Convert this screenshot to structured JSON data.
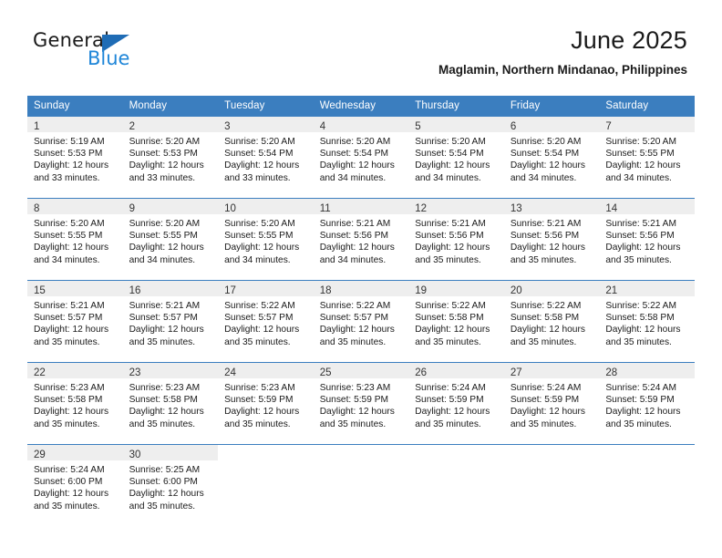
{
  "brand": {
    "name_top": "General",
    "name_bottom": "Blue",
    "triangle_color": "#1f6cb5",
    "blue_text_color": "#1f86d8"
  },
  "header": {
    "title": "June 2025",
    "subtitle": "Maglamin, Northern Mindanao, Philippines"
  },
  "theme": {
    "header_bg": "#3b7ebf",
    "header_text": "#ffffff",
    "daynum_bg": "#eeeeee",
    "grid_line": "#3b7ebf"
  },
  "calendar": {
    "weekday_headers": [
      "Sunday",
      "Monday",
      "Tuesday",
      "Wednesday",
      "Thursday",
      "Friday",
      "Saturday"
    ],
    "labels": {
      "sunrise": "Sunrise:",
      "sunset": "Sunset:",
      "daylight": "Daylight:"
    },
    "weeks": [
      [
        {
          "day": "1",
          "sunrise": "Sunrise: 5:19 AM",
          "sunset": "Sunset: 5:53 PM",
          "daylight_1": "Daylight: 12 hours",
          "daylight_2": "and 33 minutes."
        },
        {
          "day": "2",
          "sunrise": "Sunrise: 5:20 AM",
          "sunset": "Sunset: 5:53 PM",
          "daylight_1": "Daylight: 12 hours",
          "daylight_2": "and 33 minutes."
        },
        {
          "day": "3",
          "sunrise": "Sunrise: 5:20 AM",
          "sunset": "Sunset: 5:54 PM",
          "daylight_1": "Daylight: 12 hours",
          "daylight_2": "and 33 minutes."
        },
        {
          "day": "4",
          "sunrise": "Sunrise: 5:20 AM",
          "sunset": "Sunset: 5:54 PM",
          "daylight_1": "Daylight: 12 hours",
          "daylight_2": "and 34 minutes."
        },
        {
          "day": "5",
          "sunrise": "Sunrise: 5:20 AM",
          "sunset": "Sunset: 5:54 PM",
          "daylight_1": "Daylight: 12 hours",
          "daylight_2": "and 34 minutes."
        },
        {
          "day": "6",
          "sunrise": "Sunrise: 5:20 AM",
          "sunset": "Sunset: 5:54 PM",
          "daylight_1": "Daylight: 12 hours",
          "daylight_2": "and 34 minutes."
        },
        {
          "day": "7",
          "sunrise": "Sunrise: 5:20 AM",
          "sunset": "Sunset: 5:55 PM",
          "daylight_1": "Daylight: 12 hours",
          "daylight_2": "and 34 minutes."
        }
      ],
      [
        {
          "day": "8",
          "sunrise": "Sunrise: 5:20 AM",
          "sunset": "Sunset: 5:55 PM",
          "daylight_1": "Daylight: 12 hours",
          "daylight_2": "and 34 minutes."
        },
        {
          "day": "9",
          "sunrise": "Sunrise: 5:20 AM",
          "sunset": "Sunset: 5:55 PM",
          "daylight_1": "Daylight: 12 hours",
          "daylight_2": "and 34 minutes."
        },
        {
          "day": "10",
          "sunrise": "Sunrise: 5:20 AM",
          "sunset": "Sunset: 5:55 PM",
          "daylight_1": "Daylight: 12 hours",
          "daylight_2": "and 34 minutes."
        },
        {
          "day": "11",
          "sunrise": "Sunrise: 5:21 AM",
          "sunset": "Sunset: 5:56 PM",
          "daylight_1": "Daylight: 12 hours",
          "daylight_2": "and 34 minutes."
        },
        {
          "day": "12",
          "sunrise": "Sunrise: 5:21 AM",
          "sunset": "Sunset: 5:56 PM",
          "daylight_1": "Daylight: 12 hours",
          "daylight_2": "and 35 minutes."
        },
        {
          "day": "13",
          "sunrise": "Sunrise: 5:21 AM",
          "sunset": "Sunset: 5:56 PM",
          "daylight_1": "Daylight: 12 hours",
          "daylight_2": "and 35 minutes."
        },
        {
          "day": "14",
          "sunrise": "Sunrise: 5:21 AM",
          "sunset": "Sunset: 5:56 PM",
          "daylight_1": "Daylight: 12 hours",
          "daylight_2": "and 35 minutes."
        }
      ],
      [
        {
          "day": "15",
          "sunrise": "Sunrise: 5:21 AM",
          "sunset": "Sunset: 5:57 PM",
          "daylight_1": "Daylight: 12 hours",
          "daylight_2": "and 35 minutes."
        },
        {
          "day": "16",
          "sunrise": "Sunrise: 5:21 AM",
          "sunset": "Sunset: 5:57 PM",
          "daylight_1": "Daylight: 12 hours",
          "daylight_2": "and 35 minutes."
        },
        {
          "day": "17",
          "sunrise": "Sunrise: 5:22 AM",
          "sunset": "Sunset: 5:57 PM",
          "daylight_1": "Daylight: 12 hours",
          "daylight_2": "and 35 minutes."
        },
        {
          "day": "18",
          "sunrise": "Sunrise: 5:22 AM",
          "sunset": "Sunset: 5:57 PM",
          "daylight_1": "Daylight: 12 hours",
          "daylight_2": "and 35 minutes."
        },
        {
          "day": "19",
          "sunrise": "Sunrise: 5:22 AM",
          "sunset": "Sunset: 5:58 PM",
          "daylight_1": "Daylight: 12 hours",
          "daylight_2": "and 35 minutes."
        },
        {
          "day": "20",
          "sunrise": "Sunrise: 5:22 AM",
          "sunset": "Sunset: 5:58 PM",
          "daylight_1": "Daylight: 12 hours",
          "daylight_2": "and 35 minutes."
        },
        {
          "day": "21",
          "sunrise": "Sunrise: 5:22 AM",
          "sunset": "Sunset: 5:58 PM",
          "daylight_1": "Daylight: 12 hours",
          "daylight_2": "and 35 minutes."
        }
      ],
      [
        {
          "day": "22",
          "sunrise": "Sunrise: 5:23 AM",
          "sunset": "Sunset: 5:58 PM",
          "daylight_1": "Daylight: 12 hours",
          "daylight_2": "and 35 minutes."
        },
        {
          "day": "23",
          "sunrise": "Sunrise: 5:23 AM",
          "sunset": "Sunset: 5:58 PM",
          "daylight_1": "Daylight: 12 hours",
          "daylight_2": "and 35 minutes."
        },
        {
          "day": "24",
          "sunrise": "Sunrise: 5:23 AM",
          "sunset": "Sunset: 5:59 PM",
          "daylight_1": "Daylight: 12 hours",
          "daylight_2": "and 35 minutes."
        },
        {
          "day": "25",
          "sunrise": "Sunrise: 5:23 AM",
          "sunset": "Sunset: 5:59 PM",
          "daylight_1": "Daylight: 12 hours",
          "daylight_2": "and 35 minutes."
        },
        {
          "day": "26",
          "sunrise": "Sunrise: 5:24 AM",
          "sunset": "Sunset: 5:59 PM",
          "daylight_1": "Daylight: 12 hours",
          "daylight_2": "and 35 minutes."
        },
        {
          "day": "27",
          "sunrise": "Sunrise: 5:24 AM",
          "sunset": "Sunset: 5:59 PM",
          "daylight_1": "Daylight: 12 hours",
          "daylight_2": "and 35 minutes."
        },
        {
          "day": "28",
          "sunrise": "Sunrise: 5:24 AM",
          "sunset": "Sunset: 5:59 PM",
          "daylight_1": "Daylight: 12 hours",
          "daylight_2": "and 35 minutes."
        }
      ],
      [
        {
          "day": "29",
          "sunrise": "Sunrise: 5:24 AM",
          "sunset": "Sunset: 6:00 PM",
          "daylight_1": "Daylight: 12 hours",
          "daylight_2": "and 35 minutes."
        },
        {
          "day": "30",
          "sunrise": "Sunrise: 5:25 AM",
          "sunset": "Sunset: 6:00 PM",
          "daylight_1": "Daylight: 12 hours",
          "daylight_2": "and 35 minutes."
        },
        {
          "day": "",
          "sunrise": "",
          "sunset": "",
          "daylight_1": "",
          "daylight_2": ""
        },
        {
          "day": "",
          "sunrise": "",
          "sunset": "",
          "daylight_1": "",
          "daylight_2": ""
        },
        {
          "day": "",
          "sunrise": "",
          "sunset": "",
          "daylight_1": "",
          "daylight_2": ""
        },
        {
          "day": "",
          "sunrise": "",
          "sunset": "",
          "daylight_1": "",
          "daylight_2": ""
        },
        {
          "day": "",
          "sunrise": "",
          "sunset": "",
          "daylight_1": "",
          "daylight_2": ""
        }
      ]
    ]
  }
}
